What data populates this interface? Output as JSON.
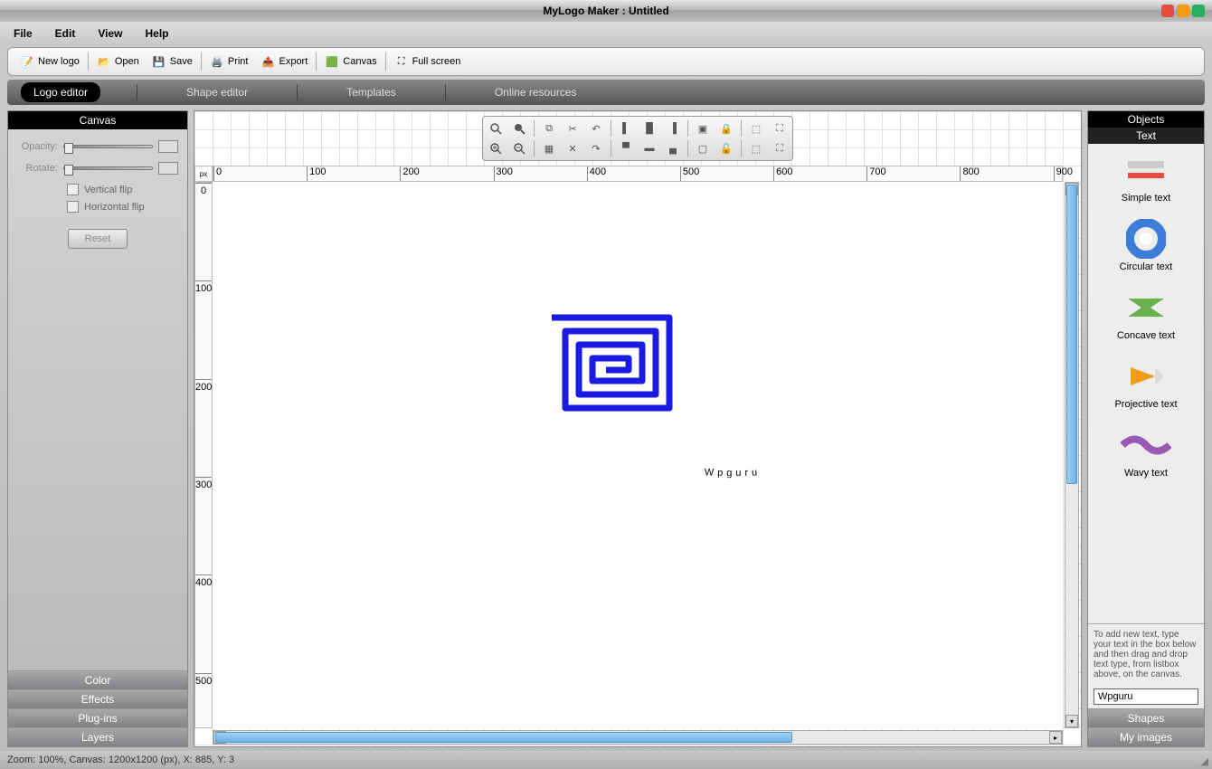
{
  "title": "MyLogo Maker : Untitled",
  "menu": {
    "file": "File",
    "edit": "Edit",
    "view": "View",
    "help": "Help"
  },
  "toolbar": {
    "newlogo": "New logo",
    "open": "Open",
    "save": "Save",
    "print": "Print",
    "export": "Export",
    "canvas": "Canvas",
    "fullscreen": "Full screen"
  },
  "tabs": {
    "logo": "Logo editor",
    "shape": "Shape editor",
    "templates": "Templates",
    "online": "Online resources"
  },
  "left": {
    "header": "Canvas",
    "opacity": "Opacity:",
    "rotate": "Rotate:",
    "vflip": "Vertical flip",
    "hflip": "Horizontal flip",
    "reset": "Reset",
    "color": "Color",
    "effects": "Effects",
    "plugins": "Plug-ins",
    "layers": "Layers"
  },
  "ruler": {
    "unit": "px",
    "h": [
      "0",
      "100",
      "200",
      "300",
      "400",
      "500",
      "600",
      "700",
      "800",
      "900"
    ],
    "v": [
      "0",
      "100",
      "200",
      "300",
      "400",
      "500"
    ]
  },
  "canvas": {
    "text": "Wpguru"
  },
  "right": {
    "objects": "Objects",
    "text_header": "Text",
    "simple": "Simple text",
    "circular": "Circular text",
    "concave": "Concave text",
    "projective": "Projective text",
    "wavy": "Wavy text",
    "help": "To add new text, type your text in the box below and then drag and drop text type, from listbox above, on the canvas.",
    "input_value": "Wpguru",
    "shapes": "Shapes",
    "myimages": "My images"
  },
  "status": "Zoom: 100%, Canvas: 1200x1200 (px), X: 885, Y: 3"
}
